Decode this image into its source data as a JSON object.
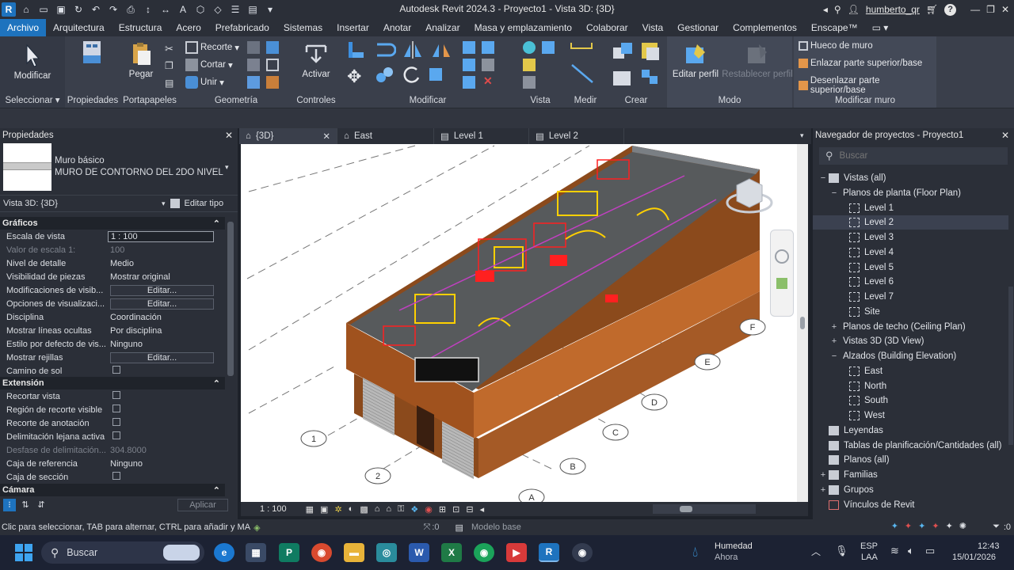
{
  "app": {
    "title": "Autodesk Revit 2024.3 - Proyecto1 - Vista 3D: {3D}",
    "user": "humberto_qr"
  },
  "menu": {
    "tabs": [
      "Archivo",
      "Arquitectura",
      "Estructura",
      "Acero",
      "Prefabricado",
      "Sistemas",
      "Insertar",
      "Anotar",
      "Analizar",
      "Masa y emplazamiento",
      "Colaborar",
      "Vista",
      "Gestionar",
      "Complementos",
      "Enscape™"
    ]
  },
  "ribbon": {
    "modificar": "Modificar",
    "seleccionar": "Seleccionar",
    "propiedades": "Propiedades",
    "pegar": "Pegar",
    "portapapeles": "Portapapeles",
    "recorte": "Recorte",
    "cortar": "Cortar",
    "unir": "Unir",
    "geometria": "Geometría",
    "activar": "Activar",
    "controles": "Controles",
    "modificar_group": "Modificar",
    "vista": "Vista",
    "medir": "Medir",
    "crear": "Crear",
    "editar_perfil": "Editar perfil",
    "restablecer_perfil": "Restablecer perfil",
    "modo": "Modo",
    "hueco_muro": "Hueco de muro",
    "enlazar": "Enlazar parte superior/base",
    "desenlazar": "Desenlazar parte superior/base",
    "modificar_muro": "Modificar muro"
  },
  "properties": {
    "header": "Propiedades",
    "family": "Muro básico",
    "type": "MURO DE CONTORNO DEL 2DO NIVEL",
    "view_selector": "Vista 3D: {3D}",
    "edit_type": "Editar tipo",
    "sections": {
      "graficos": "Gráficos",
      "extension": "Extensión",
      "camara": "Cámara"
    },
    "graficos": [
      {
        "k": "Escala de vista",
        "v": "1 : 100",
        "kind": "input"
      },
      {
        "k": "Valor de escala    1:",
        "v": "100",
        "kind": "dim"
      },
      {
        "k": "Nivel de detalle",
        "v": "Medio",
        "kind": "text"
      },
      {
        "k": "Visibilidad de piezas",
        "v": "Mostrar original",
        "kind": "text"
      },
      {
        "k": "Modificaciones de visib...",
        "v": "Editar...",
        "kind": "button"
      },
      {
        "k": "Opciones de visualizaci...",
        "v": "Editar...",
        "kind": "button"
      },
      {
        "k": "Disciplina",
        "v": "Coordinación",
        "kind": "text"
      },
      {
        "k": "Mostrar líneas ocultas",
        "v": "Por disciplina",
        "kind": "text"
      },
      {
        "k": "Estilo por defecto de vis...",
        "v": "Ninguno",
        "kind": "text"
      },
      {
        "k": "Mostrar rejillas",
        "v": "Editar...",
        "kind": "button"
      },
      {
        "k": "Camino de sol",
        "v": "",
        "kind": "check"
      }
    ],
    "extension": [
      {
        "k": "Recortar vista",
        "v": "",
        "kind": "check"
      },
      {
        "k": "Región de recorte visible",
        "v": "",
        "kind": "check"
      },
      {
        "k": "Recorte de anotación",
        "v": "",
        "kind": "check"
      },
      {
        "k": "Delimitación lejana activa",
        "v": "",
        "kind": "check"
      },
      {
        "k": "Desfase de delimitación...",
        "v": "304.8000",
        "kind": "dim"
      },
      {
        "k": "Caja de referencia",
        "v": "Ninguno",
        "kind": "text"
      },
      {
        "k": "Caja de sección",
        "v": "",
        "kind": "check"
      }
    ],
    "apply": "Aplicar"
  },
  "view_tabs": [
    {
      "label": "{3D}",
      "active": true
    },
    {
      "label": "East",
      "active": false
    },
    {
      "label": "Level 1",
      "active": false
    },
    {
      "label": "Level 2",
      "active": false
    }
  ],
  "view_scale": "1 : 100",
  "grid_labels": [
    "F",
    "E",
    "D",
    "C",
    "B",
    "A",
    "1",
    "2"
  ],
  "browser": {
    "header": "Navegador de proyectos - Proyecto1",
    "search_placeholder": "Buscar",
    "nodes": [
      {
        "t": "Vistas (all)",
        "lvl": 0,
        "tg": "−",
        "icon": "views"
      },
      {
        "t": "Planos de planta (Floor Plan)",
        "lvl": 1,
        "tg": "−"
      },
      {
        "t": "Level 1",
        "lvl": 2,
        "icon": "view"
      },
      {
        "t": "Level 2",
        "lvl": 2,
        "icon": "view",
        "sel": true
      },
      {
        "t": "Level 3",
        "lvl": 2,
        "icon": "view"
      },
      {
        "t": "Level 4",
        "lvl": 2,
        "icon": "view"
      },
      {
        "t": "Level 5",
        "lvl": 2,
        "icon": "view"
      },
      {
        "t": "Level 6",
        "lvl": 2,
        "icon": "view"
      },
      {
        "t": "Level 7",
        "lvl": 2,
        "icon": "view"
      },
      {
        "t": "Site",
        "lvl": 2,
        "icon": "view"
      },
      {
        "t": "Planos de techo (Ceiling Plan)",
        "lvl": 1,
        "tg": "+"
      },
      {
        "t": "Vistas 3D (3D View)",
        "lvl": 1,
        "tg": "+"
      },
      {
        "t": "Alzados (Building Elevation)",
        "lvl": 1,
        "tg": "−"
      },
      {
        "t": "East",
        "lvl": 2,
        "icon": "view"
      },
      {
        "t": "North",
        "lvl": 2,
        "icon": "view"
      },
      {
        "t": "South",
        "lvl": 2,
        "icon": "view"
      },
      {
        "t": "West",
        "lvl": 2,
        "icon": "view"
      },
      {
        "t": "Leyendas",
        "lvl": 0,
        "icon": "sheet"
      },
      {
        "t": "Tablas de planificación/Cantidades (all)",
        "lvl": 0,
        "icon": "sheet"
      },
      {
        "t": "Planos (all)",
        "lvl": 0,
        "icon": "sheet"
      },
      {
        "t": "Familias",
        "lvl": 0,
        "tg": "+",
        "icon": "fam"
      },
      {
        "t": "Grupos",
        "lvl": 0,
        "tg": "+",
        "icon": "fam"
      },
      {
        "t": "Vínculos de Revit",
        "lvl": 0,
        "icon": "link"
      }
    ]
  },
  "status": {
    "hint": "Clic para seleccionar, TAB para alternar, CTRL para añadir y MA",
    "count": ":0",
    "model": "Modelo base",
    "filter": ":0"
  },
  "taskbar": {
    "search": "Buscar",
    "weather_title": "Humedad",
    "weather_sub": "Ahora",
    "lang": "ESP",
    "lang_sub": "LAA",
    "time": "12:43",
    "date": "15/01/2026"
  },
  "colors": {
    "accent": "#1e73be",
    "panel": "#2b2f38",
    "ribbon": "#3a3f4b"
  }
}
